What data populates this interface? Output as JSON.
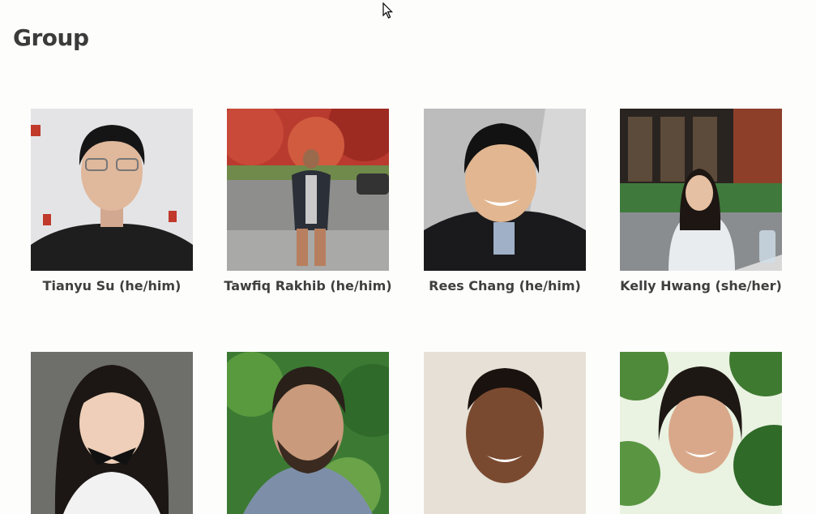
{
  "page": {
    "title": "Group"
  },
  "members": [
    {
      "name": "Tianyu Su (he/him)",
      "photo_icon": "person-photo"
    },
    {
      "name": "Tawfiq Rakhib (he/him)",
      "photo_icon": "person-photo"
    },
    {
      "name": "Rees Chang (he/him)",
      "photo_icon": "person-photo"
    },
    {
      "name": "Kelly Hwang (she/her)",
      "photo_icon": "person-photo"
    },
    {
      "name": "",
      "photo_icon": "person-photo"
    },
    {
      "name": "",
      "photo_icon": "person-photo"
    },
    {
      "name": "",
      "photo_icon": "person-photo"
    },
    {
      "name": "",
      "photo_icon": "person-photo"
    }
  ],
  "colors": {
    "background": "#fdfdfc",
    "text": "#3f3f3f"
  }
}
